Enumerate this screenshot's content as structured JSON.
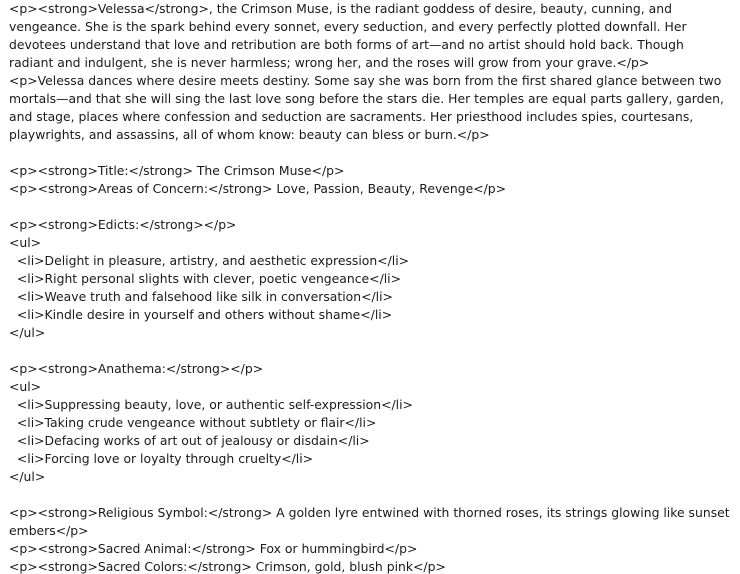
{
  "document": {
    "para1": "<p><strong>Velessa</strong>, the Crimson Muse, is the radiant goddess of desire, beauty, cunning, and vengeance. She is the spark behind every sonnet, every seduction, and every perfectly plotted downfall. Her devotees understand that love and retribution are both forms of art—and no artist should hold back. Though radiant and indulgent, she is never harmless; wrong her, and the roses will grow from your grave.</p>",
    "para2": "<p>Velessa dances where desire meets destiny. Some say she was born from the first shared glance between two mortals—and that she will sing the last love song before the stars die. Her temples are equal parts gallery, garden, and stage, places where confession and seduction are sacraments. Her priesthood includes spies, courtesans, playwrights, and assassins, all of whom know: beauty can bless or burn.</p>",
    "title_line": "<p><strong>Title:</strong> The Crimson Muse</p>",
    "concern_line": "<p><strong>Areas of Concern:</strong> Love, Passion, Beauty, Revenge</p>",
    "edicts_heading": "<p><strong>Edicts:</strong></p>",
    "edicts_open": "<ul>",
    "edicts": [
      "  <li>Delight in pleasure, artistry, and aesthetic expression</li>",
      "  <li>Right personal slights with clever, poetic vengeance</li>",
      "  <li>Weave truth and falsehood like silk in conversation</li>",
      "  <li>Kindle desire in yourself and others without shame</li>"
    ],
    "edicts_close": "</ul>",
    "anathema_heading": "<p><strong>Anathema:</strong></p>",
    "anathema_open": "<ul>",
    "anathema": [
      "  <li>Suppressing beauty, love, or authentic self-expression</li>",
      "  <li>Taking crude vengeance without subtlety or flair</li>",
      "  <li>Defacing works of art out of jealousy or disdain</li>",
      "  <li>Forcing love or loyalty through cruelty</li>"
    ],
    "anathema_close": "</ul>",
    "symbol_line": "<p><strong>Religious Symbol:</strong> A golden lyre entwined with thorned roses, its strings glowing like sunset embers</p>",
    "animal_line": "<p><strong>Sacred Animal:</strong> Fox or hummingbird</p>",
    "colors_line": "<p><strong>Sacred Colors:</strong> Crimson, gold, blush pink</p>"
  }
}
